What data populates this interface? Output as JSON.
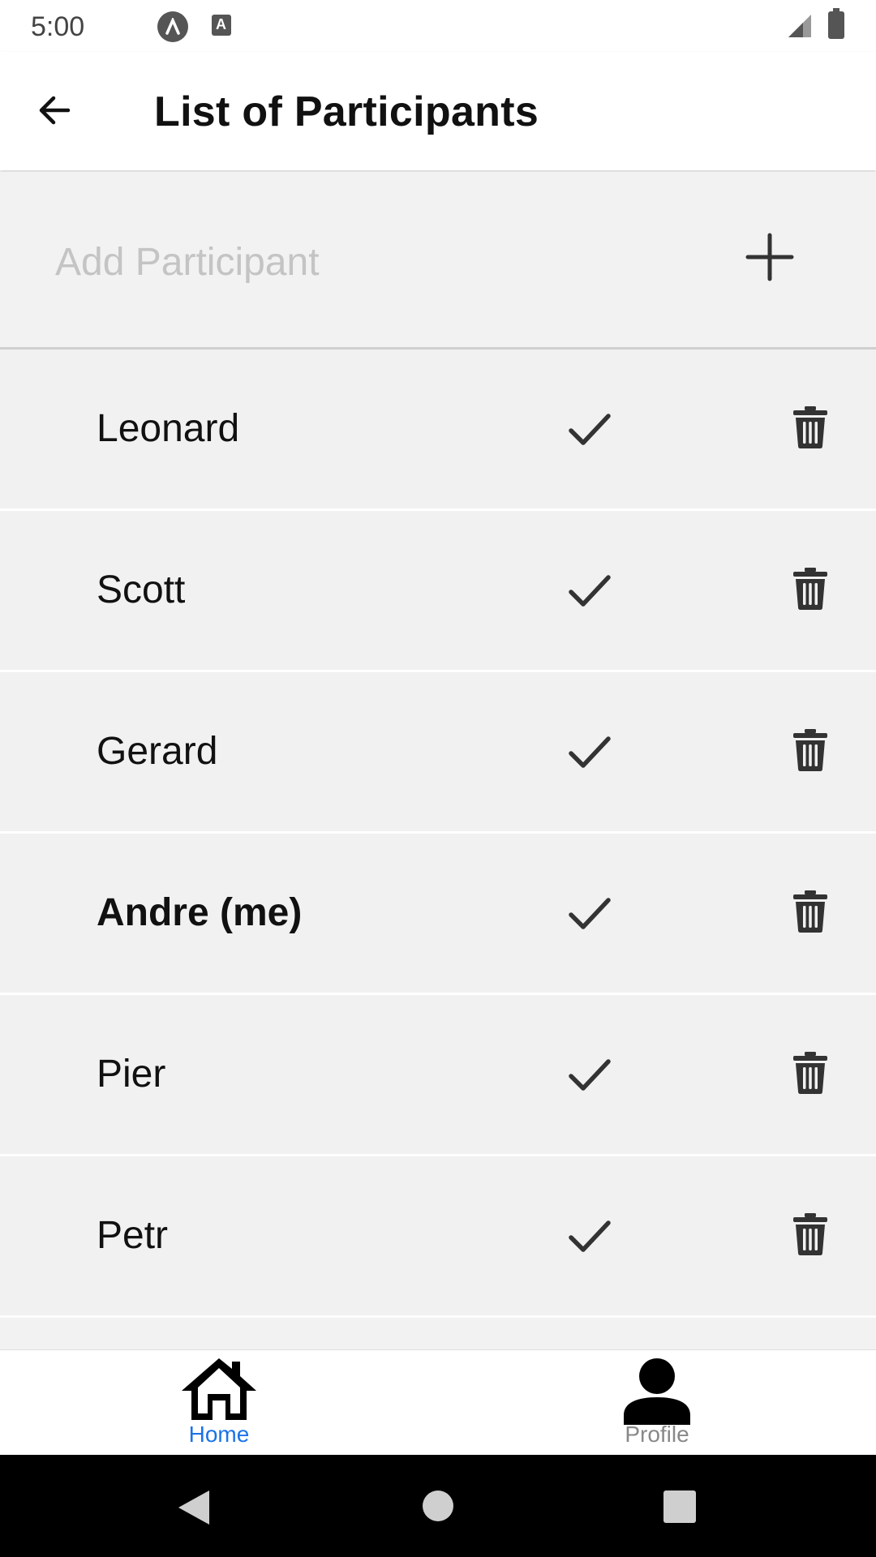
{
  "status_bar": {
    "time": "5:00",
    "icon_b_letter": "A"
  },
  "app_bar": {
    "title": "List of Participants"
  },
  "add_participant": {
    "placeholder": "Add Participant",
    "value": ""
  },
  "participants": [
    {
      "name": "Leonard",
      "is_me": false
    },
    {
      "name": "Scott",
      "is_me": false
    },
    {
      "name": "Gerard",
      "is_me": false
    },
    {
      "name": "Andre (me)",
      "is_me": true
    },
    {
      "name": "Pier",
      "is_me": false
    },
    {
      "name": "Petr",
      "is_me": false
    }
  ],
  "bottom_nav": {
    "items": [
      {
        "label": "Home",
        "icon": "home-icon",
        "active": true
      },
      {
        "label": "Profile",
        "icon": "profile-icon",
        "active": false
      }
    ]
  },
  "colors": {
    "accent": "#1a73e8",
    "inactive": "#888888",
    "row_bg": "#f1f1f1"
  }
}
